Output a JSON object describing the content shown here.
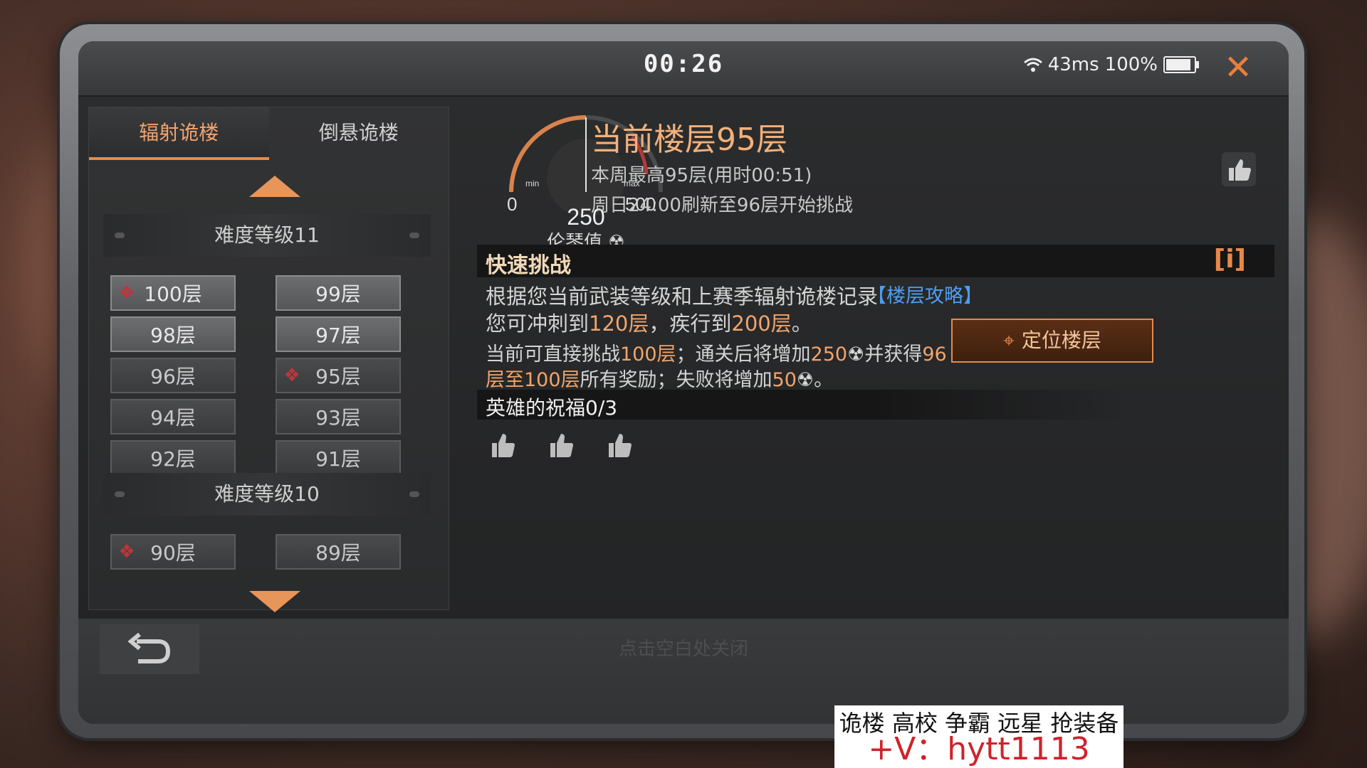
{
  "topbar": {
    "timer": "00:26",
    "ping": "43ms",
    "battery": "100%",
    "battery_fraction": 1.0
  },
  "tabs": [
    {
      "label": "辐射诡楼",
      "active": true
    },
    {
      "label": "倒悬诡楼",
      "active": false
    }
  ],
  "levels": [
    {
      "title": "难度等级11",
      "floors": [
        {
          "label": "100层",
          "marked": true,
          "selected": true
        },
        {
          "label": "99层"
        },
        {
          "label": "98层"
        },
        {
          "label": "97层"
        },
        {
          "label": "96层"
        },
        {
          "label": "95层",
          "marked": true
        },
        {
          "label": "94层"
        },
        {
          "label": "93层"
        },
        {
          "label": "92层"
        },
        {
          "label": "91层"
        }
      ]
    },
    {
      "title": "难度等级10",
      "floors": [
        {
          "label": "90层",
          "marked": true
        },
        {
          "label": "89层"
        }
      ]
    }
  ],
  "gauge": {
    "min_label": "min",
    "max_label": "max",
    "min_value": "0",
    "max_value": "500",
    "value": "250",
    "value_num": 250,
    "range": [
      0,
      500
    ],
    "caption": "伦琴值"
  },
  "floor_info": {
    "current": "当前楼层95层",
    "weekly_best": "本周最高95层(用时00:51)",
    "refresh": "周日24:00刷新至96层开始挑战"
  },
  "quick_challenge": {
    "title": "快速挑战",
    "info_icon": "[i]",
    "line1": "根据您当前武装等级和上赛季辐射诡楼记录",
    "line2a": "您可冲刺到",
    "line2b": "120层",
    "line2c": "，疾行到",
    "line2d": "200层",
    "line2e": "。",
    "guide_link": "【楼层攻略】",
    "line3a": "当前可直接挑战",
    "line3b": "100层",
    "line3c": "；通关后将增加",
    "line3d": "250",
    "line3e": "并获得",
    "line3f": "96",
    "line4a": "层至100层",
    "line4b": "所有奖励；失败将增加",
    "line4c": "50",
    "line4d": "。",
    "locate_button": "定位楼层"
  },
  "blessing": {
    "title": "英雄的祝福0/3"
  },
  "footer": {
    "close_hint": "点击空白处关闭"
  },
  "overlay_ad": {
    "line1": "诡楼 高校 争霸 远星 抢装备",
    "line2": "+V：hytt1113"
  },
  "colors": {
    "accent": "#e8894a",
    "link": "#4e9ef2",
    "mark": "#c0353a"
  },
  "icons": {
    "close": "close-icon",
    "wifi": "wifi-icon",
    "battery": "battery-icon",
    "locate": "crosshair-icon",
    "radiation": "radiation-icon",
    "thumb": "thumbs-up-icon",
    "back": "back-arrow-icon"
  }
}
